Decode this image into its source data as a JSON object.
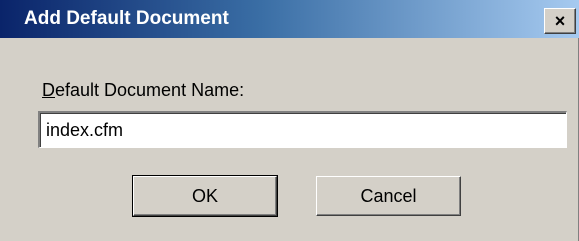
{
  "window": {
    "title": "Add Default Document",
    "close_glyph": "×",
    "colors": {
      "titlebar_start": "#0a246a",
      "titlebar_end": "#a6caf0",
      "face": "#d4d0c8"
    }
  },
  "form": {
    "label_mnemonic": "D",
    "label_rest": "efault Document Name:",
    "input_value": "index.cfm"
  },
  "buttons": {
    "ok_label": "OK",
    "cancel_label": "Cancel"
  }
}
